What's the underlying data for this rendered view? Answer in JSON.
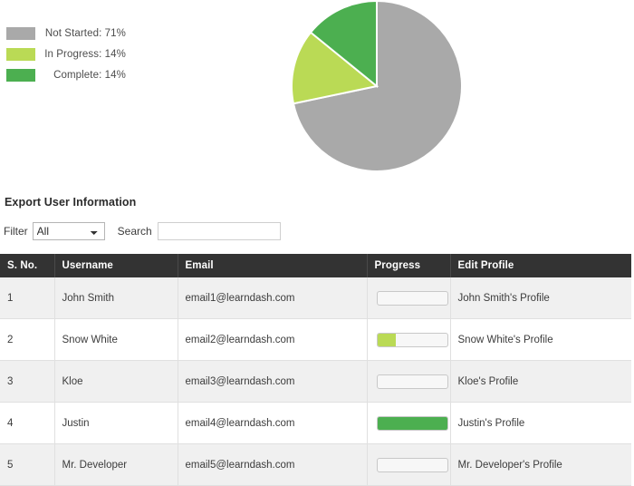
{
  "chart_data": {
    "type": "pie",
    "title": "",
    "labels": [
      "Not Started",
      "In Progress",
      "Complete"
    ],
    "values": [
      71,
      14,
      14
    ],
    "value_suffix": "%",
    "colors": [
      "#a9a9a9",
      "#bada55",
      "#4caf50"
    ],
    "legend_position": "left",
    "legend_entries": [
      {
        "label": "Not Started: 71%",
        "color": "#a9a9a9"
      },
      {
        "label": "In Progress: 14%",
        "color": "#bada55"
      },
      {
        "label": "Complete: 14%",
        "color": "#4caf50"
      }
    ],
    "start_angle_deg": 0,
    "direction": "clockwise",
    "slice_border_color": "#ffffff"
  },
  "export": {
    "heading": "Export User Information",
    "filter_label": "Filter",
    "filter_value": "All",
    "filter_options": [
      "All"
    ],
    "search_label": "Search",
    "search_value": "",
    "search_placeholder": ""
  },
  "table": {
    "columns": [
      "S. No.",
      "Username",
      "Email",
      "Progress",
      "Edit Profile"
    ],
    "rows": [
      {
        "sno": "1",
        "username": "John Smith",
        "email": "email1@learndash.com",
        "progress": 0,
        "progress_state": "not-started",
        "edit": "John Smith's Profile"
      },
      {
        "sno": "2",
        "username": "Snow White",
        "email": "email2@learndash.com",
        "progress": 27,
        "progress_state": "in-progress",
        "edit": "Snow White's Profile"
      },
      {
        "sno": "3",
        "username": "Kloe",
        "email": "email3@learndash.com",
        "progress": 0,
        "progress_state": "not-started",
        "edit": "Kloe's Profile"
      },
      {
        "sno": "4",
        "username": "Justin",
        "email": "email4@learndash.com",
        "progress": 100,
        "progress_state": "complete",
        "edit": "Justin's Profile"
      },
      {
        "sno": "5",
        "username": "Mr. Developer",
        "email": "email5@learndash.com",
        "progress": 0,
        "progress_state": "not-started",
        "edit": "Mr. Developer's Profile"
      }
    ]
  }
}
